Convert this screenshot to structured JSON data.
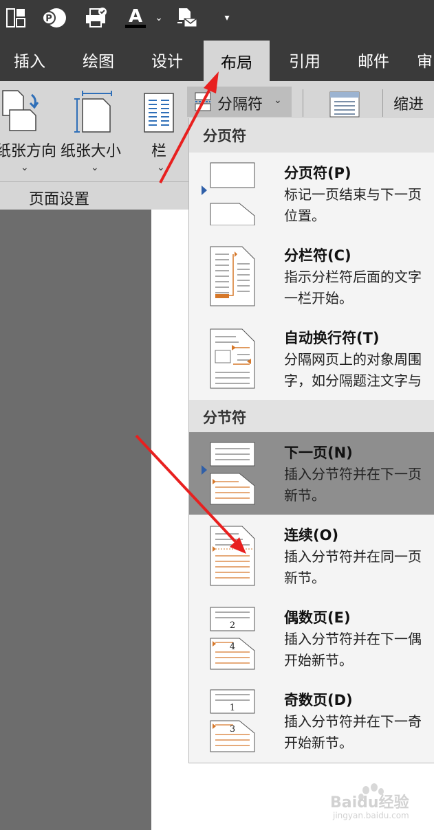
{
  "tabs": [
    {
      "label": "插入"
    },
    {
      "label": "绘图"
    },
    {
      "label": "设计"
    },
    {
      "label": "布局"
    },
    {
      "label": "引用"
    },
    {
      "label": "邮件"
    },
    {
      "label": "审"
    }
  ],
  "ribbon": {
    "orientation_label": "纸张方向",
    "size_label": "纸张大小",
    "columns_label": "栏",
    "breaks_label": "分隔符",
    "indent_label": "缩进",
    "group_label": "页面设置"
  },
  "menu": {
    "page_breaks_header": "分页符",
    "section_breaks_header": "分节符",
    "items": [
      {
        "title": "分页符(P)",
        "line1": "标记一页结束与下一页",
        "line2": "位置。"
      },
      {
        "title": "分栏符(C)",
        "line1": "指示分栏符后面的文字",
        "line2": "一栏开始。"
      },
      {
        "title": "自动换行符(T)",
        "line1": "分隔网页上的对象周围",
        "line2": "字，如分隔题注文字与"
      },
      {
        "title": "下一页(N)",
        "line1": "插入分节符并在下一页",
        "line2": "新节。"
      },
      {
        "title": "连续(O)",
        "line1": "插入分节符并在同一页",
        "line2": "新节。"
      },
      {
        "title": "偶数页(E)",
        "line1": "插入分节符并在下一偶",
        "line2": "开始新节。"
      },
      {
        "title": "奇数页(D)",
        "line1": "插入分节符并在下一奇",
        "line2": "开始新节。"
      }
    ],
    "icon_numbers": {
      "even_top": "2",
      "even_bottom": "4",
      "odd_top": "1",
      "odd_bottom": "3"
    }
  },
  "watermark": {
    "text": "Baidu经验",
    "sub": "jingyan.baidu.com"
  },
  "colors": {
    "accent_orange": "#d6782a",
    "arrow_red": "#e8201f",
    "selected_bg": "#8e8e8e"
  }
}
